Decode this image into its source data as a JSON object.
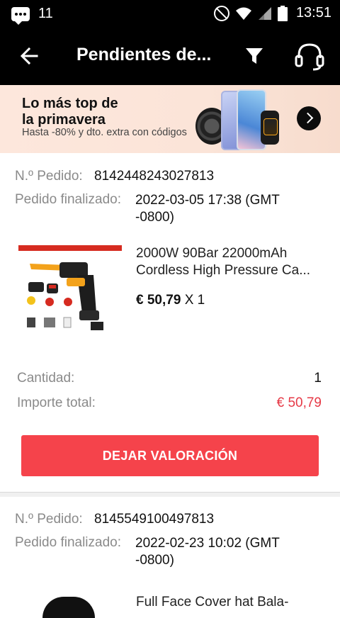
{
  "status_bar": {
    "notif_count": "11",
    "time": "13:51"
  },
  "app_bar": {
    "title": "Pendientes de..."
  },
  "banner": {
    "title_line1": "Lo más top de",
    "title_line2": "la primavera",
    "subtitle": "Hasta -80% y dto. extra con códigos"
  },
  "labels": {
    "order_no": "N.º Pedido:",
    "finalized": "Pedido finalizado:",
    "quantity": "Cantidad:",
    "total": "Importe total:",
    "review_button": "DEJAR VALORACIÓN"
  },
  "orders": [
    {
      "order_no": "8142448243027813",
      "finalized_line1": "2022-03-05 17:38 (GMT",
      "finalized_line2": "-0800)",
      "product_line1": "2000W 90Bar 22000mAh",
      "product_line2": "Cordless High Pressure Ca...",
      "price": "€ 50,79",
      "multiplier": "X 1",
      "quantity": "1",
      "total": "€ 50,79"
    },
    {
      "order_no": "8145549100497813",
      "finalized_line1": "2022-02-23 10:02 (GMT",
      "finalized_line2": "-0800)",
      "product_line1": "Full Face Cover hat Bala-"
    }
  ],
  "colors": {
    "accent": "#f5434b",
    "price_red": "#e63946",
    "app_bar": "#000000"
  }
}
